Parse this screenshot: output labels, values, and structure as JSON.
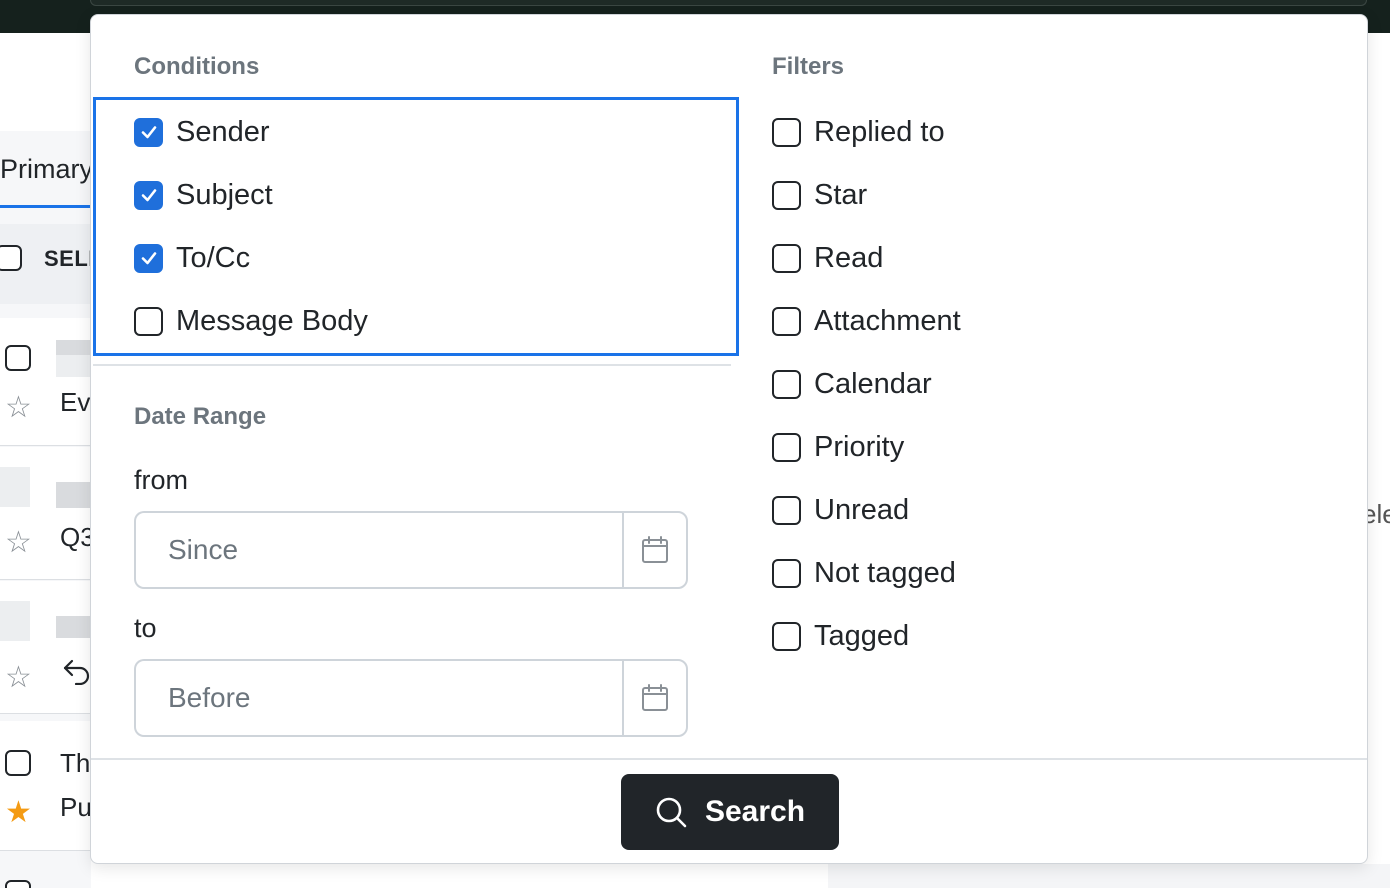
{
  "background": {
    "primary_tab": "Primary",
    "select_all": "SELI",
    "rows": [
      {
        "text": "Ev",
        "star": false
      },
      {
        "text": "Q3",
        "star": false
      },
      {
        "text": "",
        "star": false,
        "icon": "reply-icon"
      },
      {
        "text": "Th",
        "subtext": "Pu",
        "star": true
      }
    ],
    "right_text": "ele"
  },
  "dialog": {
    "conditions": {
      "title": "Conditions",
      "items": [
        {
          "label": "Sender",
          "checked": true
        },
        {
          "label": "Subject",
          "checked": true
        },
        {
          "label": "To/Cc",
          "checked": true
        },
        {
          "label": "Message Body",
          "checked": false
        }
      ]
    },
    "date_range": {
      "title": "Date Range",
      "from_label": "from",
      "from_placeholder": "Since",
      "to_label": "to",
      "to_placeholder": "Before"
    },
    "filters": {
      "title": "Filters",
      "items": [
        {
          "label": "Replied to",
          "checked": false
        },
        {
          "label": "Star",
          "checked": false
        },
        {
          "label": "Read",
          "checked": false
        },
        {
          "label": "Attachment",
          "checked": false
        },
        {
          "label": "Calendar",
          "checked": false
        },
        {
          "label": "Priority",
          "checked": false
        },
        {
          "label": "Unread",
          "checked": false
        },
        {
          "label": "Not tagged",
          "checked": false
        },
        {
          "label": "Tagged",
          "checked": false
        }
      ]
    },
    "search_button": "Search"
  },
  "colors": {
    "accent": "#1a73e8",
    "checkbox_checked": "#1f6fdb",
    "button_dark": "#212529",
    "star_filled": "#f49b14"
  }
}
